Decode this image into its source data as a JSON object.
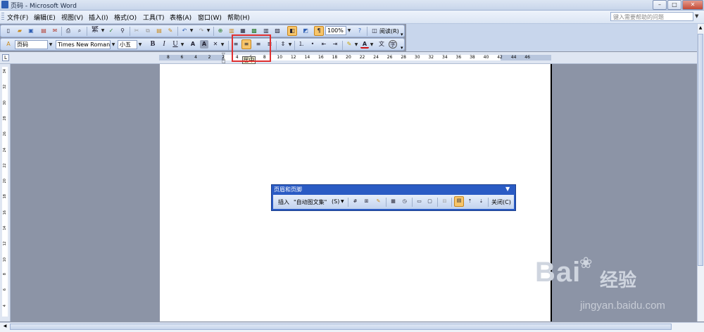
{
  "window": {
    "title": "页码 - Microsoft Word",
    "min": "–",
    "max": "□",
    "close": "✕"
  },
  "menu": {
    "items": [
      "文件(F)",
      "编辑(E)",
      "视图(V)",
      "插入(I)",
      "格式(O)",
      "工具(T)",
      "表格(A)",
      "窗口(W)",
      "帮助(H)"
    ],
    "help_placeholder": "键入需要帮助的问题"
  },
  "toolbar_standard": {
    "zoom": "100%",
    "read_label": "阅读(R)",
    "trad_label": "繁"
  },
  "toolbar_format": {
    "style": "页码",
    "font": "Times New Roman",
    "size": "小五",
    "bold": "B",
    "italic": "I",
    "underline": "U",
    "font_color_glyph": "A",
    "char_border": "A",
    "char_shade": "A",
    "phonetic": "文",
    "encircle": "字"
  },
  "tooltip": "居中",
  "ruler": {
    "h_ticks": [
      "8",
      "6",
      "4",
      "2",
      "2",
      "4",
      "6",
      "8",
      "10",
      "12",
      "14",
      "16",
      "18",
      "20",
      "22",
      "24",
      "26",
      "28",
      "30",
      "32",
      "34",
      "36",
      "38",
      "40",
      "42",
      "44",
      "46"
    ],
    "v_ticks": [
      "34",
      "32",
      "30",
      "28",
      "26",
      "24",
      "22",
      "20",
      "18",
      "16",
      "14",
      "12",
      "10",
      "8",
      "6",
      "4"
    ]
  },
  "header_footer_toolbar": {
    "title": "页眉和页脚",
    "insert": "插入",
    "autotext": "\"自动图文集\"",
    "autotext_key": "(S)",
    "close": "关闭(C)"
  },
  "watermark": {
    "brand": "Bai",
    "brand2": "经验",
    "url": "jingyan.baidu.com"
  },
  "colors": {
    "highlight": "#e03030",
    "title_bar": "#2a5bc4",
    "active_button": "#f7c56a"
  }
}
